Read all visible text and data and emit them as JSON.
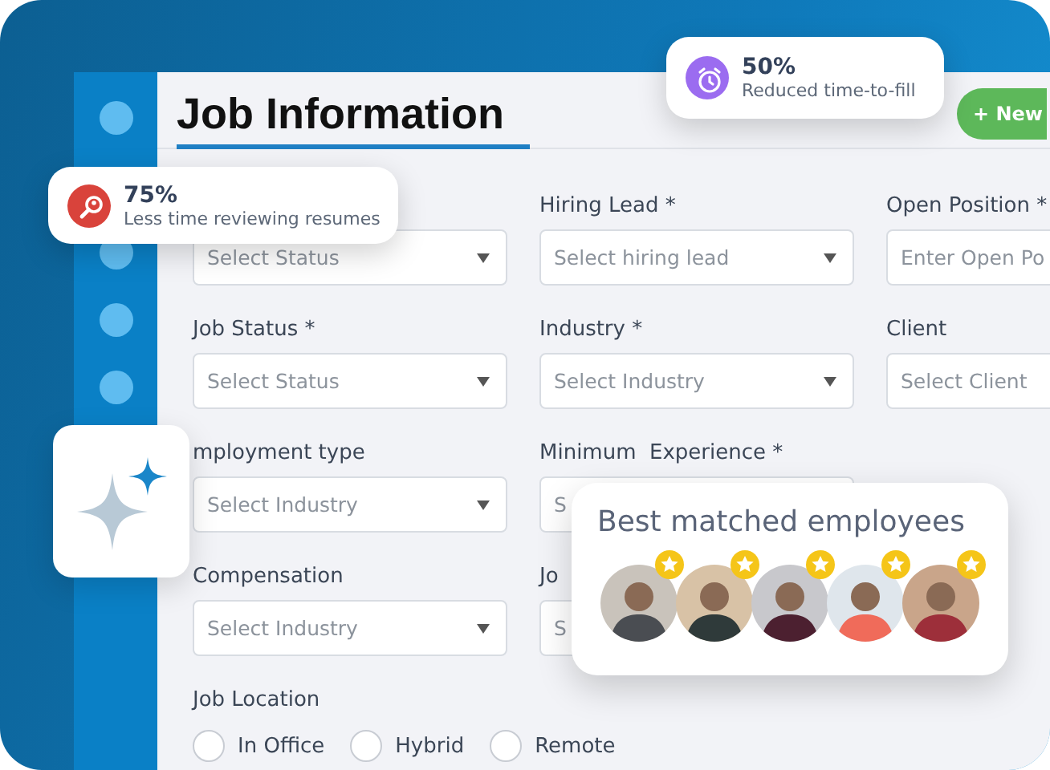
{
  "app": {
    "title": "Job Information",
    "new_button": "+ New"
  },
  "form": {
    "rows": [
      [
        {
          "placeholder": "Select Status",
          "kind": "select"
        },
        {
          "label": "Hiring Lead *",
          "placeholder": "Select hiring lead",
          "kind": "select"
        },
        {
          "label": "Open Position *",
          "placeholder": "Enter Open Po",
          "kind": "input"
        }
      ],
      [
        {
          "label": "Job Status *",
          "placeholder": "Select Status",
          "kind": "select"
        },
        {
          "label": "Industry *",
          "placeholder": "Select Industry",
          "kind": "select"
        },
        {
          "label": "Client",
          "placeholder": "Select Client",
          "kind": "input"
        }
      ],
      [
        {
          "label": "mployment type",
          "placeholder": "Select Industry",
          "kind": "select"
        },
        {
          "label": "Minimum  Experience *",
          "placeholder": "S",
          "kind": "input"
        }
      ],
      [
        {
          "label": "Compensation",
          "placeholder": "Select Industry",
          "kind": "select"
        },
        {
          "label": "Jo",
          "placeholder": "S",
          "kind": "input"
        }
      ]
    ],
    "job_location": {
      "label": "Job Location",
      "options": [
        {
          "label": "In Office",
          "selected": false
        },
        {
          "label": "Hybrid",
          "selected": false
        },
        {
          "label": "Remote",
          "selected": false
        }
      ]
    }
  },
  "stats": [
    {
      "value": "50%",
      "caption": "Reduced time-to-fill",
      "kind": "alarm",
      "color": "#9b6cf0"
    },
    {
      "value": "75%",
      "caption": "Less time reviewing resumes",
      "kind": "search",
      "color": "#d9433b"
    }
  ],
  "matches": {
    "title": "Best matched employees",
    "people": [
      {
        "starred": true
      },
      {
        "starred": true
      },
      {
        "starred": true
      },
      {
        "starred": true
      },
      {
        "starred": true
      }
    ]
  }
}
